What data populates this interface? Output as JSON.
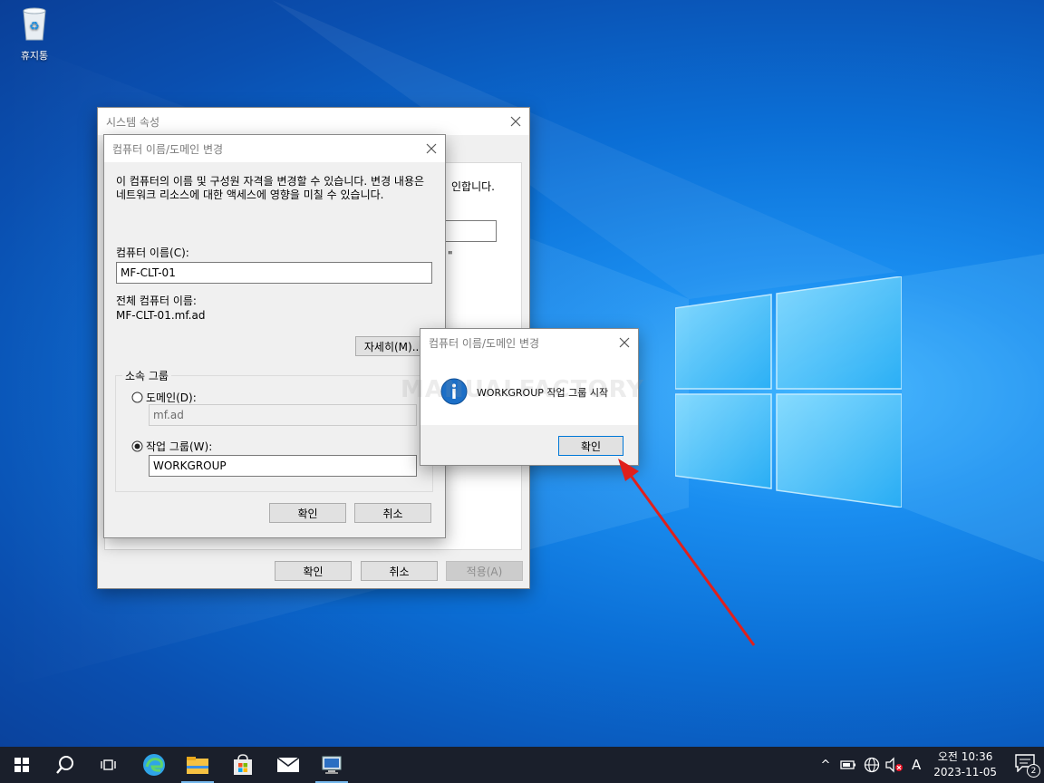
{
  "desktop": {
    "recycle_bin_label": "휴지통",
    "watermark": "MANUALFACTORY"
  },
  "system_props": {
    "title": "시스템 속성",
    "partial_text_1": "인합니다.",
    "partial_text_2": "\"",
    "ok_label": "확인",
    "cancel_label": "취소",
    "apply_label": "적용(A)"
  },
  "change_dialog": {
    "title": "컴퓨터 이름/도메인 변경",
    "description": "이 컴퓨터의 이름 및 구성원 자격을 변경할 수 있습니다. 변경 내용은 네트워크 리소스에 대한 액세스에 영향을 미칠 수 있습니다.",
    "computer_name_label": "컴퓨터 이름(C):",
    "computer_name_value": "MF-CLT-01",
    "full_name_label": "전체 컴퓨터 이름:",
    "full_name_value": "MF-CLT-01.mf.ad",
    "more_button": "자세히(M)...",
    "member_of_label": "소속 그룹",
    "domain_label": "도메인(D):",
    "domain_value": "mf.ad",
    "workgroup_label": "작업 그룹(W):",
    "workgroup_value": "WORKGROUP",
    "selected_option": "workgroup",
    "ok_label": "확인",
    "cancel_label": "취소"
  },
  "message_box": {
    "title": "컴퓨터 이름/도메인 변경",
    "message": "WORKGROUP 작업 그룹 시작",
    "icon": "info-icon",
    "ok_label": "확인"
  },
  "taskbar": {
    "items": [
      "start-icon",
      "search-icon",
      "task-view-icon",
      "edge-icon",
      "file-explorer-icon",
      "store-icon",
      "mail-icon",
      "system-properties-icon"
    ],
    "ime_label": "A",
    "time": "오전 10:36",
    "date": "2023-11-05",
    "notification_count": "2"
  },
  "colors": {
    "accent": "#0078d7",
    "arrow": "#e0201c",
    "taskbar": "#1a1f2b"
  }
}
